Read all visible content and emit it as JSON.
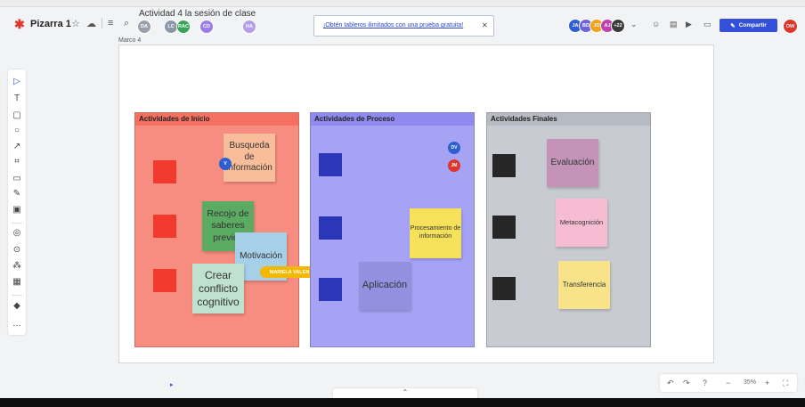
{
  "header": {
    "board_name": "Pizarra 1",
    "doc_title": "Actividad 4 la sesión de clase",
    "promo_text": "¡Obtén tableros ilimitados con una prueba gratuita!",
    "share_label": "Compartir",
    "avatar_count": "+22"
  },
  "title_avatars": [
    "DA",
    "LC",
    "RAC",
    "CD",
    "HA"
  ],
  "right_avatars": [
    "JA",
    "BD",
    "JO",
    "AJ"
  ],
  "user_avatar": "OW",
  "frame": {
    "label": "Marco 4"
  },
  "columns": {
    "inicio": {
      "title": "Actividades de Inicio"
    },
    "proceso": {
      "title": "Actividades de Proceso"
    },
    "finales": {
      "title": "Actividades Finales"
    }
  },
  "stickies": {
    "busqueda": "Busqueda de información",
    "recojo": "Recojo de saberes previos",
    "motivacion": "Motivación",
    "crear": "Crear conflicto cognitivo",
    "procesamiento": "Procesamiento de información",
    "aplicacion": "Aplicación",
    "evaluacion": "Evaluación",
    "metacognicion": "Metacognición",
    "transferencia": "Transferencia"
  },
  "cursors": {
    "v": "V",
    "dv": "DV",
    "jm": "JM",
    "name_tag": "MARIELA VALEN"
  },
  "zoom": {
    "level": "35%"
  },
  "colors": {
    "inicio_bg": "#f78d80",
    "proceso_bg": "#a6a3f5",
    "finales_bg": "#c8cbd2",
    "brand": "#3350d8"
  }
}
